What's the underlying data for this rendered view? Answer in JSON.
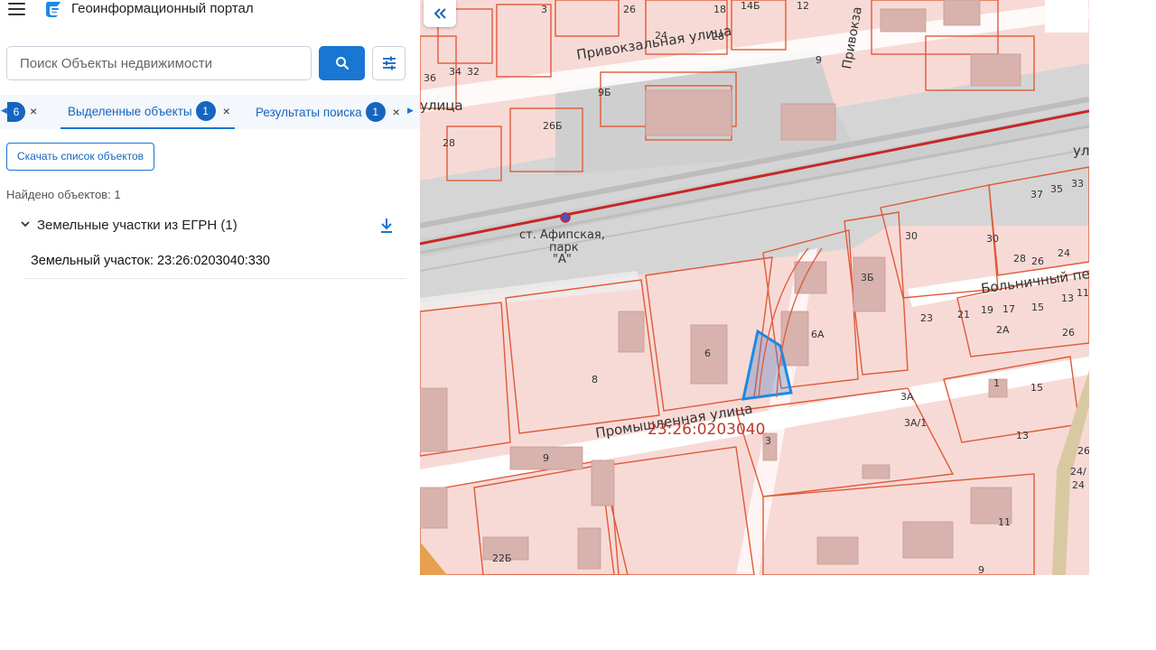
{
  "header": {
    "title": "Геоинформационный портал",
    "menu_icon": "hamburger-menu-icon",
    "logo_icon": "portal-logo-icon"
  },
  "search": {
    "placeholder": "Поиск Объекты недвижимости",
    "value": "",
    "search_icon": "search-icon",
    "filter_icon": "tune-filter-icon"
  },
  "tabs": {
    "partial_badge": "6",
    "items": [
      {
        "label": "Выделенные объекты",
        "badge": "1",
        "active": true
      },
      {
        "label": "Результаты поиска",
        "badge": "1",
        "active": false
      }
    ],
    "close_glyph": "×",
    "left_arrow": "◀",
    "right_arrow": "▶"
  },
  "results": {
    "download_button": "Скачать список объектов",
    "found_text": "Найдено объектов: 1",
    "group_title": "Земельные участки из ЕГРН (1)",
    "items": [
      {
        "label": "Земельный участок: 23:26:0203040:330"
      }
    ]
  },
  "map": {
    "collapse_icon": "double-chevron-left-icon",
    "quarter_label": "23:26:0203040",
    "station_label": [
      "ст. Афипская,",
      "парк",
      "\"А\""
    ],
    "streets": {
      "privokzalnaya": "Привокзальная улица",
      "promyshlennaya": "Промышленная улица",
      "privokzalnaya_vertical": "Привокза",
      "bolnichny": "Больничный пе",
      "ulitsa_left": "улица",
      "ul_right": "ул"
    },
    "house_numbers": [
      "3",
      "26",
      "18",
      "14Б",
      "12",
      "24",
      "28",
      "9",
      "36",
      "34",
      "32",
      "9Б",
      "26Б",
      "28",
      "37",
      "35",
      "33",
      "30",
      "30",
      "28",
      "26",
      "24",
      "13",
      "11",
      "23",
      "21",
      "19",
      "17",
      "15",
      "2А",
      "26",
      "3Б",
      "6А",
      "6",
      "8",
      "3А",
      "1",
      "15",
      "3А/1",
      "13",
      "3",
      "9",
      "22Б",
      "11",
      "9",
      "26",
      "24/",
      "24"
    ],
    "colors": {
      "parcel_fill": "#f7d6d1",
      "parcel_stroke": "#e05a3a",
      "railway": "#c62828",
      "selection": "#1e88e5",
      "road": "#ffffff",
      "rail_zone": "#d9d9d9"
    }
  }
}
